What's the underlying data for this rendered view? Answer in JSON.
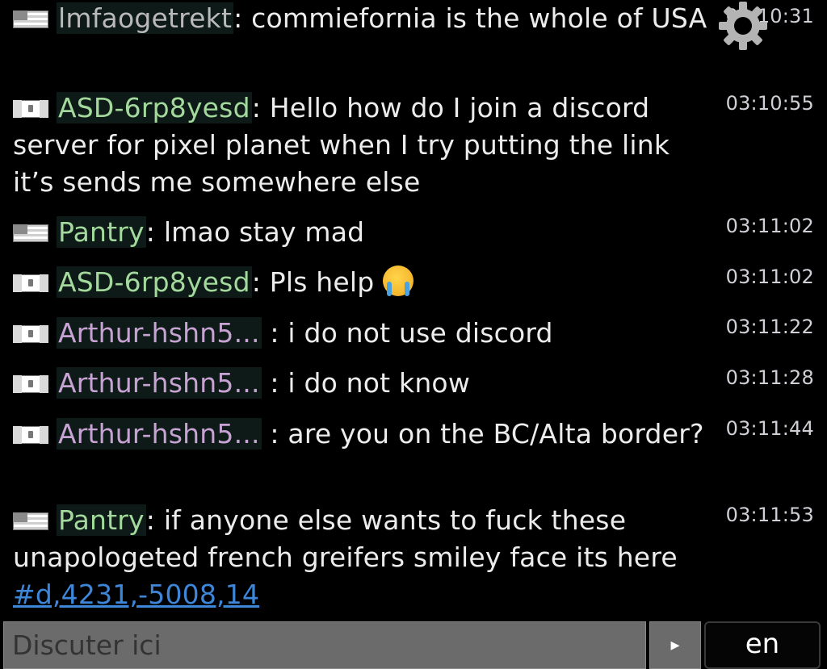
{
  "messages": [
    {
      "flag": "us",
      "user": "lmfaogetrekt",
      "user_color": "#b9b9b9",
      "sep": ": ",
      "text": "commiefornia is the whole of USA",
      "time": "03:10:31"
    },
    {
      "flag": "ca",
      "user": "ASD-6rp8yesd",
      "user_color": "#a3d99c",
      "sep": ": ",
      "text": "Hello how do I join a discord server for pixel planet when I try putting the link it’s sends me somewhere else",
      "time": "03:10:55"
    },
    {
      "flag": "us",
      "user": "Pantry",
      "user_color": "#a3d99c",
      "sep": ": ",
      "text": "lmao stay mad",
      "time": "03:11:02"
    },
    {
      "flag": "ca",
      "user": "ASD-6rp8yesd",
      "user_color": "#a3d99c",
      "sep": ": ",
      "text": "Pls help",
      "time": "03:11:02"
    },
    {
      "flag": "ca",
      "user": "Arthur-hshn5...",
      "user_color": "#c6a3d2",
      "sep": " : ",
      "text": "i do not use discord",
      "time": "03:11:22"
    },
    {
      "flag": "ca",
      "user": "Arthur-hshn5...",
      "user_color": "#c6a3d2",
      "sep": " : ",
      "text": "i do not know",
      "time": "03:11:28"
    },
    {
      "flag": "ca",
      "user": "Arthur-hshn5...",
      "user_color": "#c6a3d2",
      "sep": " : ",
      "text": "are you on the BC/Alta border?",
      "time": "03:11:44"
    },
    {
      "flag": "us",
      "user": "Pantry",
      "user_color": "#a3d99c",
      "sep": ": ",
      "text": "if anyone else wants to fuck these unapologeted french greifers smiley face its here",
      "link": "#d,4231,-5008,14",
      "time": "03:11:53"
    }
  ],
  "emoji_icon": "loudly-crying-face-icon",
  "settings_icon": "gear-icon",
  "input": {
    "placeholder": "Discuter ici",
    "value": ""
  },
  "send_button": {
    "label": "▸"
  },
  "language_button": {
    "label": "en"
  },
  "colors": {
    "background": "#000000",
    "link": "#3d86d8",
    "input_bg": "#6b6b6b"
  }
}
